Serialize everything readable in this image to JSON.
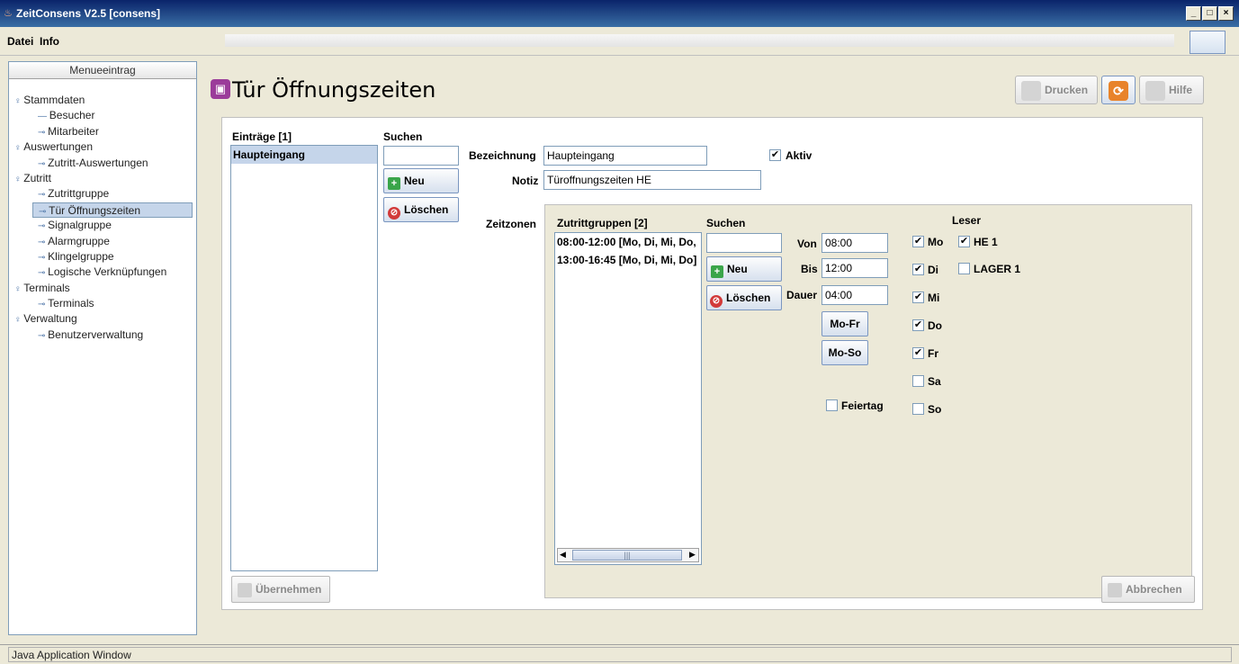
{
  "window": {
    "title": "ZeitConsens V2.5 [consens]",
    "min": "_",
    "max": "□",
    "close": "×"
  },
  "menu": [
    "Datei",
    "Info"
  ],
  "sidebar": {
    "header": "Menueeintrag",
    "items": [
      {
        "label": "Stammdaten",
        "level": 0
      },
      {
        "label": "Besucher",
        "level": 1
      },
      {
        "label": "Mitarbeiter",
        "level": 1
      },
      {
        "label": "Auswertungen",
        "level": 0
      },
      {
        "label": "Zutritt-Auswertungen",
        "level": 1
      },
      {
        "label": "Zutritt",
        "level": 0
      },
      {
        "label": "Zutrittgruppe",
        "level": 1
      },
      {
        "label": "Tür Öffnungszeiten",
        "level": 1,
        "selected": true
      },
      {
        "label": "Signalgruppe",
        "level": 1
      },
      {
        "label": "Alarmgruppe",
        "level": 1
      },
      {
        "label": "Klingelgruppe",
        "level": 1
      },
      {
        "label": "Logische Verknüpfungen",
        "level": 1
      },
      {
        "label": "Terminals",
        "level": 0
      },
      {
        "label": "Terminals",
        "level": 1
      },
      {
        "label": "Verwaltung",
        "level": 0
      },
      {
        "label": "Benutzerverwaltung",
        "level": 1
      }
    ]
  },
  "page": {
    "title": "Tür Öffnungszeiten"
  },
  "toolbar": {
    "print": "Drucken",
    "help": "Hilfe"
  },
  "entries": {
    "header": "Einträge [1]",
    "items": [
      "Haupteingang"
    ]
  },
  "search": {
    "label": "Suchen",
    "value": ""
  },
  "buttons": {
    "new": "Neu",
    "delete": "Löschen",
    "apply": "Übernehmen",
    "cancel": "Abbrechen",
    "mofr": "Mo-Fr",
    "moso": "Mo-So"
  },
  "form": {
    "bezeichnung_label": "Bezeichnung",
    "bezeichnung": "Haupteingang",
    "notiz_label": "Notiz",
    "notiz": "Türoffnungszeiten HE",
    "aktiv_label": "Aktiv",
    "aktiv": true,
    "zeitzonen_label": "Zeitzonen"
  },
  "zones": {
    "header": "Zutrittgruppen [2]",
    "items": [
      "08:00-12:00 [Mo, Di, Mi, Do,",
      "13:00-16:45 [Mo, Di, Mi, Do]"
    ],
    "search_label": "Suchen",
    "von_label": "Von",
    "von": "08:00",
    "bis_label": "Bis",
    "bis": "12:00",
    "dauer_label": "Dauer",
    "dauer": "04:00",
    "feiertag_label": "Feiertag",
    "days": [
      {
        "label": "Mo",
        "checked": true
      },
      {
        "label": "Di",
        "checked": true
      },
      {
        "label": "Mi",
        "checked": true
      },
      {
        "label": "Do",
        "checked": true
      },
      {
        "label": "Fr",
        "checked": true
      },
      {
        "label": "Sa",
        "checked": false
      },
      {
        "label": "So",
        "checked": false
      }
    ],
    "reader_label": "Leser",
    "readers": [
      {
        "label": "HE 1",
        "checked": true
      },
      {
        "label": "LAGER 1",
        "checked": false
      }
    ]
  },
  "status": "Java Application Window",
  "colors": {
    "titlebar": "#0a246a",
    "selection": "#c5d5ea",
    "accent_icon": "#9b3c9a"
  }
}
